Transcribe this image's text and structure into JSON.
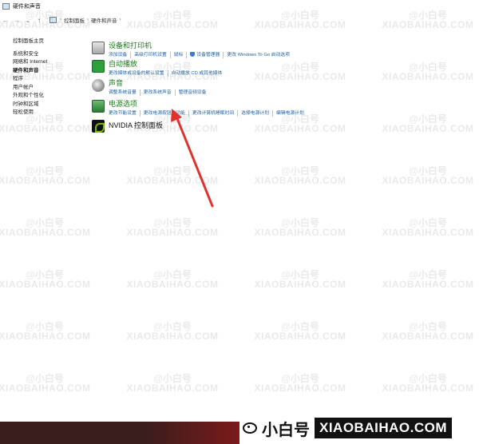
{
  "window": {
    "title": "硬件和声音"
  },
  "nav": {
    "breadcrumb": [
      "控制面板",
      "硬件和声音"
    ],
    "back_glyph": "←",
    "forward_glyph": "→",
    "recent_glyph": "⌄",
    "up_glyph": "↑",
    "separator_glyph": "›"
  },
  "sidebar": {
    "home": "控制面板主页",
    "items": [
      {
        "label": "系统和安全"
      },
      {
        "label": "网络和 Internet"
      },
      {
        "label": "硬件和声音",
        "active": true
      },
      {
        "label": "程序"
      },
      {
        "label": "用户帐户"
      },
      {
        "label": "外观和个性化"
      },
      {
        "label": "时钟和区域"
      },
      {
        "label": "轻松使用"
      }
    ]
  },
  "categories": {
    "devices": {
      "title": "设备和打印机",
      "icon": "printer-icon",
      "links": [
        "添加设备",
        "高级打印机设置",
        "鼠标",
        "设备管理器",
        "更改 Windows To Go 启动选项"
      ]
    },
    "autoplay": {
      "title": "自动播放",
      "icon": "autoplay-icon",
      "links": [
        "更改媒体或设备的默认设置",
        "自动播放 CD 或其他媒体"
      ]
    },
    "sound": {
      "title": "声音",
      "icon": "speaker-icon",
      "links": [
        "调整系统音量",
        "更改系统声音",
        "管理音频设备"
      ]
    },
    "power": {
      "title": "电源选项",
      "icon": "power-icon",
      "links": [
        "更改节能设置",
        "更改电源按钮的功能",
        "更改计算机睡眠时间",
        "选择电源计划",
        "编辑电源计划"
      ]
    },
    "nvidia": {
      "title": "NVIDIA 控制面板",
      "icon": "nvidia-icon"
    }
  },
  "watermark": {
    "brand_cn": "@小白号",
    "brand_en": "XIAOBAIHAO.COM"
  },
  "footer_brand": {
    "cn": "小白号",
    "en": "XIAOBAIHAO.COM"
  },
  "colors": {
    "category_title": "#1a7a1a",
    "link": "#2362a0",
    "arrow": "#e0322c"
  }
}
